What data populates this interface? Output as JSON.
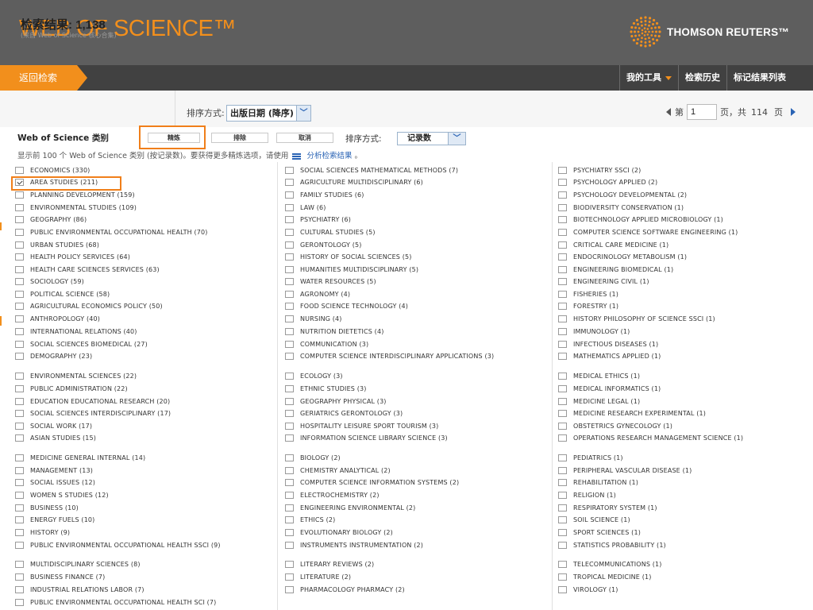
{
  "header": {
    "logo_text": "WEB OF SCIENCE™",
    "brand_name": "THOMSON REUTERS™",
    "brand_icon": "thomson-reuters-globe"
  },
  "nav": {
    "back_label": "返回检索",
    "links": [
      {
        "label": "我的工具",
        "dropdown": true
      },
      {
        "label": "检索历史",
        "dropdown": false
      },
      {
        "label": "标记结果列表",
        "dropdown": false
      }
    ]
  },
  "results": {
    "title": "检索结果: 1,138",
    "subtitle": "(来自 Web of Science 核心合集)",
    "sort_label": "排序方式:",
    "sort_value": "出版日期 (降序)",
    "pager": {
      "prefix": "第",
      "current_page": "1",
      "suffix": "页，共",
      "total_pages": "114",
      "unit": "页"
    }
  },
  "refine": {
    "category_title": "Web of Science 类别",
    "buttons": [
      "精炼",
      "排除",
      "取消"
    ],
    "sort_label": "排序方式:",
    "sort_value": "记录数",
    "hint_prefix": "显示前 100 个 Web of Science 类别 (按记录数)。要获得更多精炼选项，请使用",
    "hint_link": "分析检索结果",
    "hint_suffix": "。"
  },
  "categories": {
    "col1": [
      {
        "label": "ECONOMICS (330)",
        "checked": false
      },
      {
        "label": "AREA STUDIES (211)",
        "checked": true
      },
      {
        "label": "PLANNING DEVELOPMENT (159)",
        "checked": false
      },
      {
        "label": "ENVIRONMENTAL STUDIES (109)",
        "checked": false
      },
      {
        "label": "GEOGRAPHY (86)",
        "checked": false
      },
      {
        "label": "PUBLIC ENVIRONMENTAL OCCUPATIONAL HEALTH (70)",
        "checked": false
      },
      {
        "label": "URBAN STUDIES (68)",
        "checked": false
      },
      {
        "label": "HEALTH POLICY SERVICES (64)",
        "checked": false
      },
      {
        "label": "HEALTH CARE SCIENCES SERVICES (63)",
        "checked": false
      },
      {
        "label": "SOCIOLOGY (59)",
        "checked": false
      },
      {
        "label": "POLITICAL SCIENCE (58)",
        "checked": false
      },
      {
        "label": "AGRICULTURAL ECONOMICS POLICY (50)",
        "checked": false
      },
      {
        "label": "ANTHROPOLOGY (40)",
        "checked": false
      },
      {
        "label": "INTERNATIONAL RELATIONS (40)",
        "checked": false
      },
      {
        "label": "SOCIAL SCIENCES BIOMEDICAL (27)",
        "checked": false
      },
      {
        "label": "DEMOGRAPHY (23)",
        "checked": false
      },
      {
        "label": "ENVIRONMENTAL SCIENCES (22)",
        "checked": false
      },
      {
        "label": "PUBLIC ADMINISTRATION (22)",
        "checked": false
      },
      {
        "label": "EDUCATION EDUCATIONAL RESEARCH (20)",
        "checked": false
      },
      {
        "label": "SOCIAL SCIENCES INTERDISCIPLINARY (17)",
        "checked": false
      },
      {
        "label": "SOCIAL WORK (17)",
        "checked": false
      },
      {
        "label": "ASIAN STUDIES (15)",
        "checked": false
      },
      {
        "label": "MEDICINE GENERAL INTERNAL (14)",
        "checked": false
      },
      {
        "label": "MANAGEMENT (13)",
        "checked": false
      },
      {
        "label": "SOCIAL ISSUES (12)",
        "checked": false
      },
      {
        "label": "WOMEN S STUDIES (12)",
        "checked": false
      },
      {
        "label": "BUSINESS (10)",
        "checked": false
      },
      {
        "label": "ENERGY FUELS (10)",
        "checked": false
      },
      {
        "label": "HISTORY (9)",
        "checked": false
      },
      {
        "label": "PUBLIC ENVIRONMENTAL OCCUPATIONAL HEALTH SSCI (9)",
        "checked": false
      },
      {
        "label": "MULTIDISCIPLINARY SCIENCES (8)",
        "checked": false
      },
      {
        "label": "BUSINESS FINANCE (7)",
        "checked": false
      },
      {
        "label": "INDUSTRIAL RELATIONS LABOR (7)",
        "checked": false
      },
      {
        "label": "PUBLIC ENVIRONMENTAL OCCUPATIONAL HEALTH SCI (7)",
        "checked": false
      }
    ],
    "col2": [
      {
        "label": "SOCIAL SCIENCES MATHEMATICAL METHODS (7)",
        "checked": false
      },
      {
        "label": "AGRICULTURE MULTIDISCIPLINARY (6)",
        "checked": false
      },
      {
        "label": "FAMILY STUDIES (6)",
        "checked": false
      },
      {
        "label": "LAW (6)",
        "checked": false
      },
      {
        "label": "PSYCHIATRY (6)",
        "checked": false
      },
      {
        "label": "CULTURAL STUDIES (5)",
        "checked": false
      },
      {
        "label": "GERONTOLOGY (5)",
        "checked": false
      },
      {
        "label": "HISTORY OF SOCIAL SCIENCES (5)",
        "checked": false
      },
      {
        "label": "HUMANITIES MULTIDISCIPLINARY (5)",
        "checked": false
      },
      {
        "label": "WATER RESOURCES (5)",
        "checked": false
      },
      {
        "label": "AGRONOMY (4)",
        "checked": false
      },
      {
        "label": "FOOD SCIENCE TECHNOLOGY (4)",
        "checked": false
      },
      {
        "label": "NURSING (4)",
        "checked": false
      },
      {
        "label": "NUTRITION DIETETICS (4)",
        "checked": false
      },
      {
        "label": "COMMUNICATION (3)",
        "checked": false
      },
      {
        "label": "COMPUTER SCIENCE INTERDISCIPLINARY APPLICATIONS (3)",
        "checked": false
      },
      {
        "label": "ECOLOGY (3)",
        "checked": false
      },
      {
        "label": "ETHNIC STUDIES (3)",
        "checked": false
      },
      {
        "label": "GEOGRAPHY PHYSICAL (3)",
        "checked": false
      },
      {
        "label": "GERIATRICS GERONTOLOGY (3)",
        "checked": false
      },
      {
        "label": "HOSPITALITY LEISURE SPORT TOURISM (3)",
        "checked": false
      },
      {
        "label": "INFORMATION SCIENCE LIBRARY SCIENCE (3)",
        "checked": false
      },
      {
        "label": "BIOLOGY (2)",
        "checked": false
      },
      {
        "label": "CHEMISTRY ANALYTICAL (2)",
        "checked": false
      },
      {
        "label": "COMPUTER SCIENCE INFORMATION SYSTEMS (2)",
        "checked": false
      },
      {
        "label": "ELECTROCHEMISTRY (2)",
        "checked": false
      },
      {
        "label": "ENGINEERING ENVIRONMENTAL (2)",
        "checked": false
      },
      {
        "label": "ETHICS (2)",
        "checked": false
      },
      {
        "label": "EVOLUTIONARY BIOLOGY (2)",
        "checked": false
      },
      {
        "label": "INSTRUMENTS INSTRUMENTATION (2)",
        "checked": false
      },
      {
        "label": "LITERARY REVIEWS (2)",
        "checked": false
      },
      {
        "label": "LITERATURE (2)",
        "checked": false
      },
      {
        "label": "PHARMACOLOGY PHARMACY (2)",
        "checked": false
      }
    ],
    "col3": [
      {
        "label": "PSYCHIATRY SSCI (2)",
        "checked": false
      },
      {
        "label": "PSYCHOLOGY APPLIED (2)",
        "checked": false
      },
      {
        "label": "PSYCHOLOGY DEVELOPMENTAL (2)",
        "checked": false
      },
      {
        "label": "BIODIVERSITY CONSERVATION (1)",
        "checked": false
      },
      {
        "label": "BIOTECHNOLOGY APPLIED MICROBIOLOGY (1)",
        "checked": false
      },
      {
        "label": "COMPUTER SCIENCE SOFTWARE ENGINEERING (1)",
        "checked": false
      },
      {
        "label": "CRITICAL CARE MEDICINE (1)",
        "checked": false
      },
      {
        "label": "ENDOCRINOLOGY METABOLISM (1)",
        "checked": false
      },
      {
        "label": "ENGINEERING BIOMEDICAL (1)",
        "checked": false
      },
      {
        "label": "ENGINEERING CIVIL (1)",
        "checked": false
      },
      {
        "label": "FISHERIES (1)",
        "checked": false
      },
      {
        "label": "FORESTRY (1)",
        "checked": false
      },
      {
        "label": "HISTORY PHILOSOPHY OF SCIENCE SSCI (1)",
        "checked": false
      },
      {
        "label": "IMMUNOLOGY (1)",
        "checked": false
      },
      {
        "label": "INFECTIOUS DISEASES (1)",
        "checked": false
      },
      {
        "label": "MATHEMATICS APPLIED (1)",
        "checked": false
      },
      {
        "label": "MEDICAL ETHICS (1)",
        "checked": false
      },
      {
        "label": "MEDICAL INFORMATICS (1)",
        "checked": false
      },
      {
        "label": "MEDICINE LEGAL (1)",
        "checked": false
      },
      {
        "label": "MEDICINE RESEARCH EXPERIMENTAL (1)",
        "checked": false
      },
      {
        "label": "OBSTETRICS GYNECOLOGY (1)",
        "checked": false
      },
      {
        "label": "OPERATIONS RESEARCH MANAGEMENT SCIENCE (1)",
        "checked": false
      },
      {
        "label": "PEDIATRICS (1)",
        "checked": false
      },
      {
        "label": "PERIPHERAL VASCULAR DISEASE (1)",
        "checked": false
      },
      {
        "label": "REHABILITATION (1)",
        "checked": false
      },
      {
        "label": "RELIGION (1)",
        "checked": false
      },
      {
        "label": "RESPIRATORY SYSTEM (1)",
        "checked": false
      },
      {
        "label": "SOIL SCIENCE (1)",
        "checked": false
      },
      {
        "label": "SPORT SCIENCES (1)",
        "checked": false
      },
      {
        "label": "STATISTICS PROBABILITY (1)",
        "checked": false
      },
      {
        "label": "TELECOMMUNICATIONS (1)",
        "checked": false
      },
      {
        "label": "TROPICAL MEDICINE (1)",
        "checked": false
      },
      {
        "label": "VIROLOGY (1)",
        "checked": false
      }
    ]
  },
  "colors": {
    "accent": "#f28f1c",
    "header_bg": "#5e5e5e",
    "nav_bg": "#414141",
    "link": "#2b64b5",
    "highlight": "#f07f1a"
  }
}
